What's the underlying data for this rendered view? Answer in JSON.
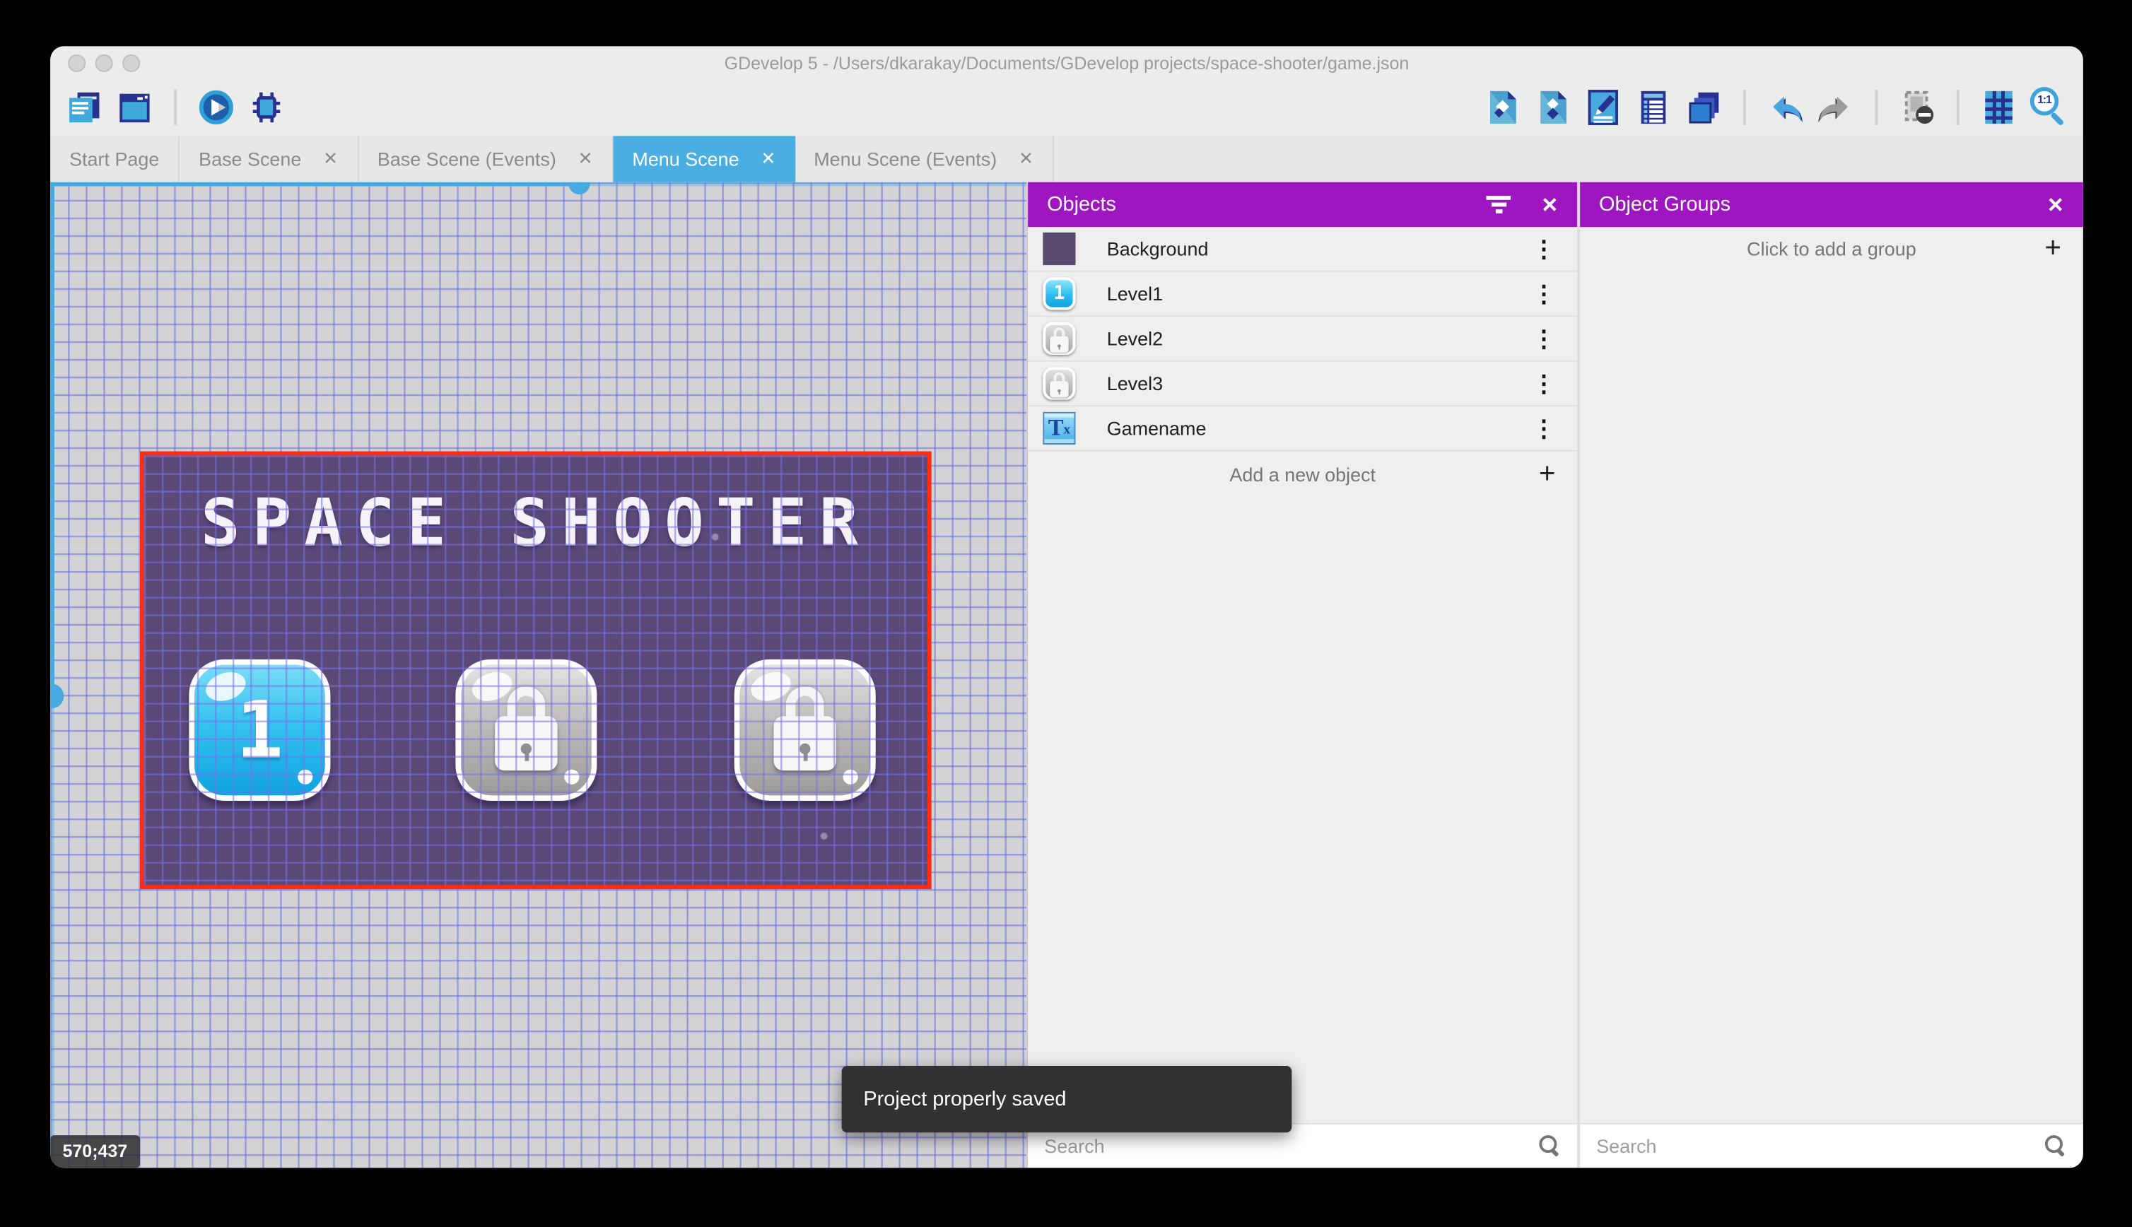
{
  "window_title": "GDevelop 5 - /Users/dkarakay/Documents/GDevelop projects/space-shooter/game.json",
  "ui": {
    "close_glyph": "✕",
    "plus_glyph": "+",
    "kebab_glyph": "⋮",
    "zoom_ratio": "1:1"
  },
  "toolbar": {
    "left_icons": [
      "project-manager",
      "scene-window",
      "play-preview",
      "debug"
    ],
    "right_icons": [
      "objects-editor",
      "object-groups",
      "properties",
      "instances-list",
      "layers",
      "undo",
      "redo",
      "mask-render",
      "grid",
      "zoom-original"
    ]
  },
  "tabs": {
    "items": [
      {
        "label": "Start Page",
        "closable": false,
        "active": false
      },
      {
        "label": "Base Scene",
        "closable": true,
        "active": false
      },
      {
        "label": "Base Scene (Events)",
        "closable": true,
        "active": false
      },
      {
        "label": "Menu Scene",
        "closable": true,
        "active": true
      },
      {
        "label": "Menu Scene (Events)",
        "closable": true,
        "active": false
      }
    ]
  },
  "canvas": {
    "coordinate_label": "570;437"
  },
  "scene": {
    "title": "SPACE SHOOTER",
    "level1_label": "1"
  },
  "objects_panel": {
    "title": "Objects",
    "rows": [
      {
        "label": "Background"
      },
      {
        "label": "Level1",
        "icon_label": "1"
      },
      {
        "label": "Level2"
      },
      {
        "label": "Level3"
      },
      {
        "label": "Gamename",
        "icon_main": "T",
        "icon_sub": "x"
      }
    ],
    "add_row_label": "Add a new object",
    "search_placeholder": "Search"
  },
  "object_groups_panel": {
    "title": "Object Groups",
    "add_row_label": "Click to add a group",
    "search_placeholder": "Search"
  },
  "toast_message": "Project properly saved",
  "colors": {
    "accent_blue": "#4AAEE2",
    "panel_purple": "#9E16C0",
    "selection_red": "#FE2C10",
    "scene_background": "#5B4A78",
    "toolbar_navy": "#27318F",
    "toolbar_blue": "#4AA9DC"
  }
}
